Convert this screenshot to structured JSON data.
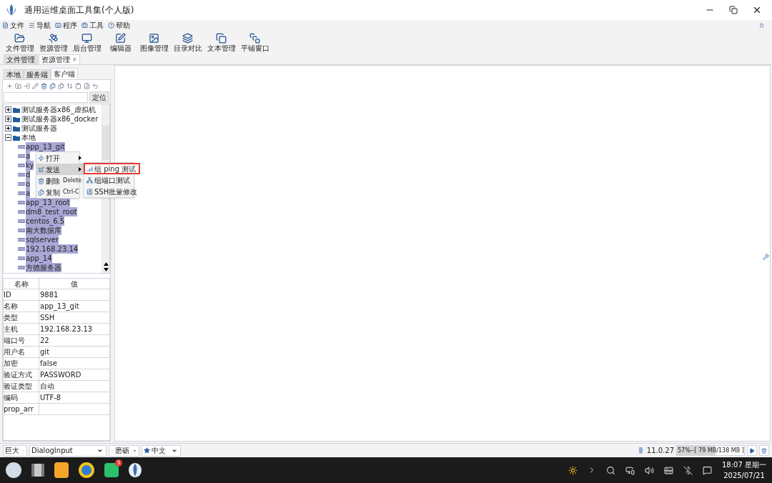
{
  "window": {
    "title": "通用运维桌面工具集(个人版)"
  },
  "menu": [
    "文件",
    "导航",
    "程序",
    "工具",
    "帮助"
  ],
  "toolbar": [
    "文件管理",
    "资源管理",
    "后台管理",
    "编辑器",
    "图像管理",
    "目录对比",
    "文本管理",
    "平铺窗口"
  ],
  "doc_tabs": [
    {
      "label": "文件管理",
      "selected": false
    },
    {
      "label": "资源管理",
      "selected": true,
      "close": "×"
    }
  ],
  "side_tabs": [
    {
      "label": "本地",
      "selected": false
    },
    {
      "label": "服务端",
      "selected": false
    },
    {
      "label": "客户端",
      "selected": true
    }
  ],
  "locate_button": "定位",
  "tree": [
    {
      "label": "测试服务器x86_虚拟机",
      "expanded": false
    },
    {
      "label": "测试服务器x86_docker",
      "expanded": false
    },
    {
      "label": "测试服务器",
      "expanded": false
    },
    {
      "label": "本地",
      "expanded": true,
      "children": [
        {
          "label": "app_13_git",
          "selected": true
        },
        {
          "label": "a",
          "selected": true
        },
        {
          "label": "ky",
          "selected": true
        },
        {
          "label": "d",
          "selected": true
        },
        {
          "label": "o",
          "selected": true
        },
        {
          "label": "a",
          "selected": true
        },
        {
          "label": "app_13_root",
          "selected": true
        },
        {
          "label": "dm8_test_root",
          "selected": true
        },
        {
          "label": "centos_6.5",
          "selected": true
        },
        {
          "label": "南大数据库",
          "selected": true
        },
        {
          "label": "sqlserver",
          "selected": true
        },
        {
          "label": "192.168.23.14",
          "selected": true
        },
        {
          "label": "app_14",
          "selected": true
        },
        {
          "label": "方德服务器",
          "selected": true
        }
      ]
    }
  ],
  "context_menu": [
    {
      "label": "打开",
      "submenu": true,
      "selected": false
    },
    {
      "label": "发送",
      "submenu": true,
      "selected": true
    },
    {
      "label": "删除",
      "shortcut": "Delete",
      "submenu": false,
      "selected": false
    },
    {
      "label": "复制",
      "shortcut": "Ctrl-C",
      "submenu": false,
      "selected": false
    }
  ],
  "submenu": [
    {
      "label": "组 ping 测试",
      "selected": true
    },
    {
      "label": "组端口测试",
      "selected": false
    },
    {
      "label": "SSH批量修改",
      "selected": false
    }
  ],
  "properties": {
    "columns": [
      "名称",
      "值"
    ],
    "rows": [
      [
        "ID",
        "9881"
      ],
      [
        "名称",
        "app_13_git"
      ],
      [
        "类型",
        "SSH"
      ],
      [
        "主机",
        "192.168.23.13"
      ],
      [
        "端口号",
        "22"
      ],
      [
        "用户名",
        "git"
      ],
      [
        "加密",
        "false"
      ],
      [
        "验证方式",
        "PASSWORD"
      ],
      [
        "验证类型",
        "自动"
      ],
      [
        "编码",
        "UTF-8"
      ],
      [
        "prop_arr",
        ""
      ]
    ]
  },
  "status_bar": {
    "font_size": "巨大",
    "font": "DialogInput",
    "theme": "磨砺",
    "language": "中文",
    "version": "11.0.27",
    "memory": {
      "text": "57%--[ 79 MB/138 MB ]",
      "level": 0.57
    }
  },
  "taskbar": {
    "badge": "3",
    "time": "18:07 星期一",
    "date": "2025/07/21"
  }
}
